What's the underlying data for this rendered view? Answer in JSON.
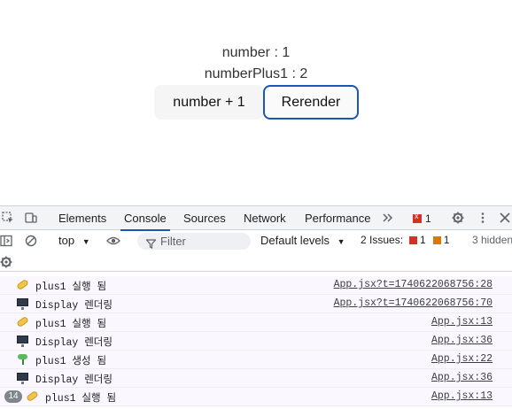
{
  "app": {
    "number_line": "number : 1",
    "number_plus1_line": "numberPlus1 : 2",
    "plus_button": "number + 1",
    "rerender_button": "Rerender"
  },
  "devtools": {
    "tabs": [
      "Elements",
      "Console",
      "Sources",
      "Network",
      "Performance"
    ],
    "active_tab": "Console",
    "more_tabs_icon": "chevron-double-right-icon",
    "error_count": "1",
    "toolbar": {
      "context": "top",
      "filter_placeholder": "Filter",
      "levels": "Default levels",
      "issues_label": "2 Issues:",
      "issues_errors": "1",
      "issues_warnings": "1",
      "hidden_label": "3 hidden"
    },
    "logs": [
      {
        "icon": "pill",
        "message": "plus1 실행 됨",
        "source": "App.jsx?t=1740622068756:28",
        "count": ""
      },
      {
        "icon": "monitor",
        "message": "Display 렌더링",
        "source": "App.jsx?t=1740622068756:70",
        "count": ""
      },
      {
        "icon": "pill",
        "message": "plus1 실행 됨",
        "source": "App.jsx:13",
        "count": ""
      },
      {
        "icon": "monitor",
        "message": "Display 렌더링",
        "source": "App.jsx:36",
        "count": ""
      },
      {
        "icon": "sprout",
        "message": "plus1 생성 됨",
        "source": "App.jsx:22",
        "count": ""
      },
      {
        "icon": "monitor",
        "message": "Display 렌더링",
        "source": "App.jsx:36",
        "count": ""
      },
      {
        "icon": "pill",
        "message": "plus1 실행 됨",
        "source": "App.jsx:13",
        "count": "14"
      }
    ],
    "colors": {
      "accent": "#1a56b4",
      "error": "#d93025",
      "warning": "#e37400"
    }
  }
}
